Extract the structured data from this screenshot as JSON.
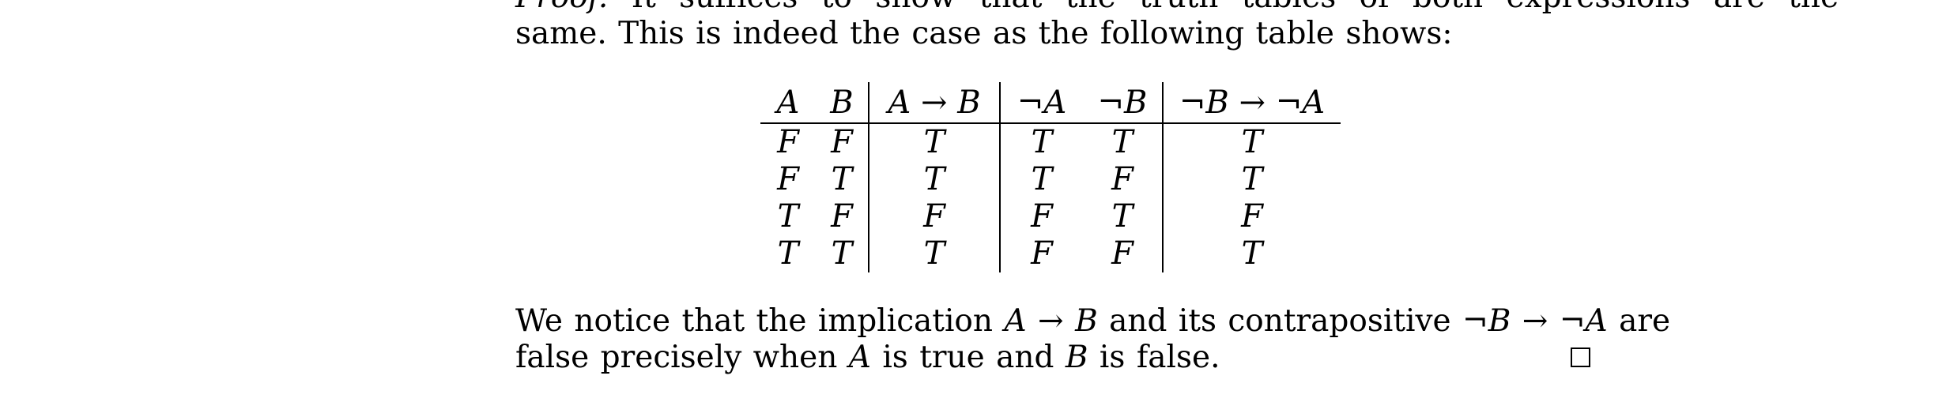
{
  "paragraph_top": {
    "clipped_line_label": "Proof.",
    "clipped_line_rest": "It suffices to show that the truth tables of both expressions are the",
    "line2": "same. This is indeed the case as the following table shows:"
  },
  "truth_table": {
    "headers": [
      "A",
      "B",
      "A → B",
      "¬A",
      "¬B",
      "¬B → ¬A"
    ],
    "rows": [
      [
        "F",
        "F",
        "T",
        "T",
        "T",
        "T"
      ],
      [
        "F",
        "T",
        "T",
        "T",
        "F",
        "T"
      ],
      [
        "T",
        "F",
        "F",
        "F",
        "T",
        "F"
      ],
      [
        "T",
        "T",
        "T",
        "F",
        "F",
        "T"
      ]
    ]
  },
  "paragraph_bottom": {
    "l1_a": "We notice that the implication ",
    "l1_m1": "A → B",
    "l1_b": " and its contrapositive ",
    "l1_m2": "¬B → ¬A",
    "l1_c": " are",
    "l2_a": "false precisely when ",
    "l2_m1": "A",
    "l2_b": " is true and ",
    "l2_m2": "B",
    "l2_c": " is false."
  },
  "qed_symbol": "end-of-proof-box"
}
